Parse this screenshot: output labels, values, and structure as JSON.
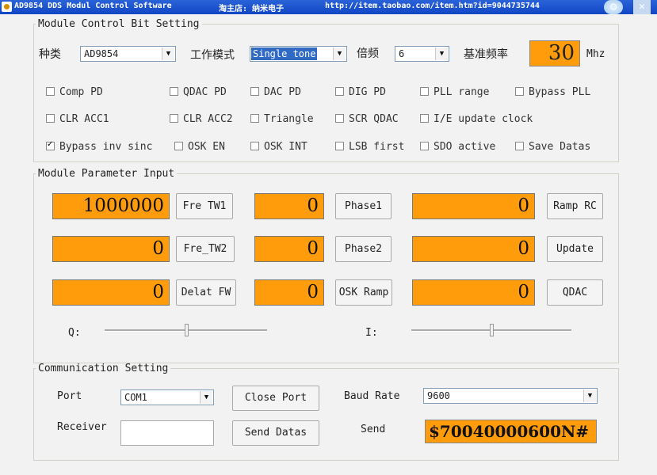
{
  "window": {
    "title": "AD9854 DDS Modul Control Software",
    "shop": "淘主店: 纳米电子",
    "url": "http://item.taobao.com/item.htm?id=9044735744"
  },
  "control_group": {
    "legend": "Module Control Bit Setting",
    "type_label": "种类",
    "type_value": "AD9854",
    "mode_label": "工作模式",
    "mode_value": "Single tone",
    "mult_label": "倍频",
    "mult_value": "6",
    "ref_label": "基准频率",
    "ref_value": "30",
    "ref_unit": "Mhz",
    "checkboxes": [
      {
        "label": "Comp PD",
        "checked": false
      },
      {
        "label": "QDAC PD",
        "checked": false
      },
      {
        "label": "DAC PD",
        "checked": false
      },
      {
        "label": "DIG PD",
        "checked": false
      },
      {
        "label": "PLL range",
        "checked": false
      },
      {
        "label": "Bypass PLL",
        "checked": false
      },
      {
        "label": "CLR ACC1",
        "checked": false
      },
      {
        "label": "CLR ACC2",
        "checked": false
      },
      {
        "label": "Triangle",
        "checked": false
      },
      {
        "label": "SCR QDAC",
        "checked": false
      },
      {
        "label": "I/E update clock",
        "checked": false
      },
      {
        "label": "Bypass inv sinc",
        "checked": true
      },
      {
        "label": "OSK EN",
        "checked": false
      },
      {
        "label": "OSK INT",
        "checked": false
      },
      {
        "label": "LSB first",
        "checked": false
      },
      {
        "label": "SDO active",
        "checked": false
      },
      {
        "label": "Save Datas",
        "checked": false
      }
    ]
  },
  "param_group": {
    "legend": "Module Parameter Input",
    "fre_tw1": "1000000",
    "fre_tw1_btn": "Fre TW1",
    "fre_tw2": "0",
    "fre_tw2_btn": "Fre_TW2",
    "delta_fw": "0",
    "delta_fw_btn": "Delat FW",
    "phase1": "0",
    "phase1_btn": "Phase1",
    "phase2": "0",
    "phase2_btn": "Phase2",
    "osk_ramp": "0",
    "osk_ramp_btn": "OSK Ramp",
    "ramp_rc": "0",
    "ramp_rc_btn": "Ramp RC",
    "update_val": "0",
    "update_btn": "Update",
    "qdac_val": "0",
    "qdac_btn": "QDAC",
    "q_label": "Q:",
    "i_label": "I:",
    "q_level": 0.5,
    "i_level": 0.5
  },
  "comm_group": {
    "legend": "Communication Setting",
    "port_label": "Port",
    "port_value": "COM1",
    "close_btn": "Close Port",
    "baud_label": "Baud Rate",
    "baud_value": "9600",
    "receiver_label": "Receiver",
    "send_btn": "Send Datas",
    "send_label": "Send",
    "send_value": "$70040000600N#"
  }
}
